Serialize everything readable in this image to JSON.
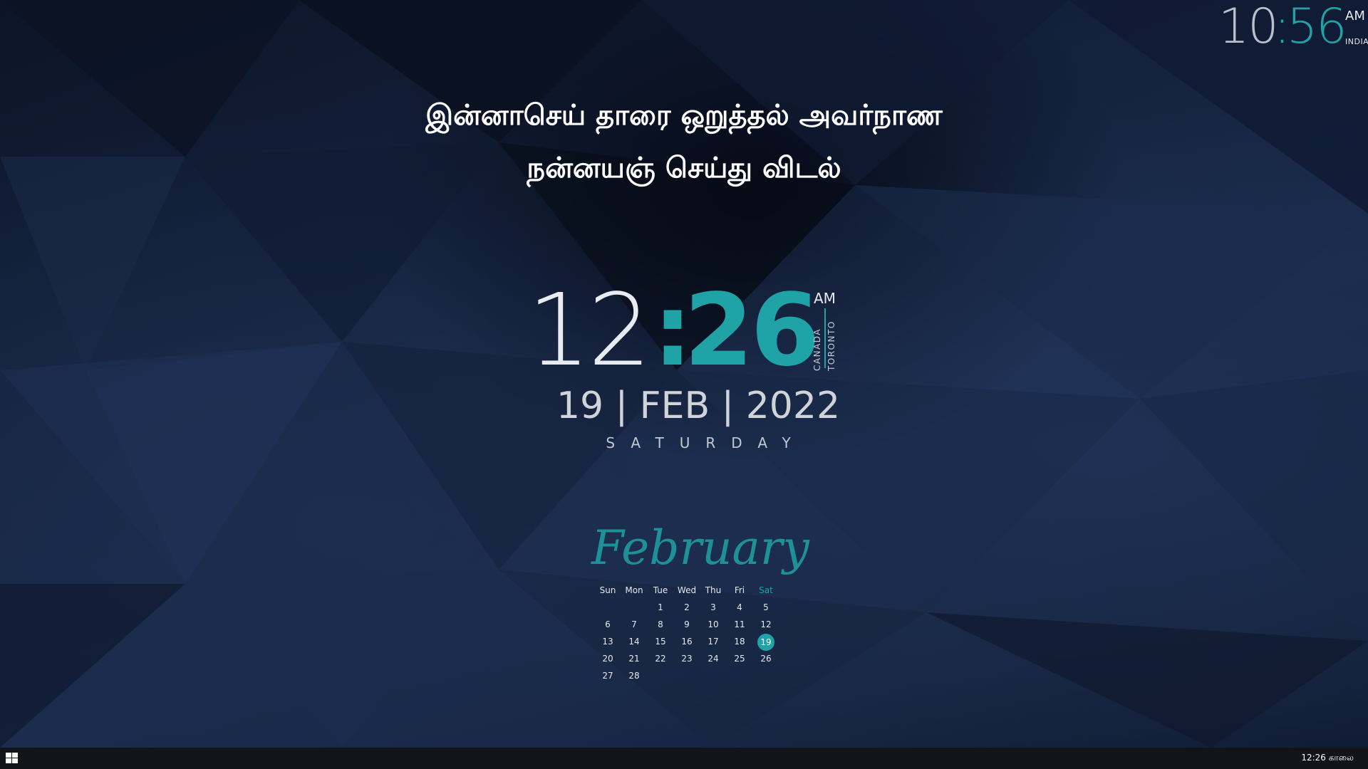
{
  "india_clock": {
    "hour": "10",
    "colon": ":",
    "minute": "56",
    "ampm": "AM",
    "zone": "INDIA"
  },
  "quote": {
    "line1": "இன்னாசெய் தாரை ஒறுத்தல் அவர்நாண",
    "line2": "நன்னயஞ் செய்து விடல்"
  },
  "main_clock": {
    "hour": "12",
    "colon": ":",
    "minute": "26",
    "ampm": "AM",
    "country": "CANADA",
    "city": "TORONTO"
  },
  "date": {
    "line": "19 | FEB | 2022",
    "weekday": "SATURDAY"
  },
  "calendar": {
    "month": "February",
    "weekdays": [
      "Sun",
      "Mon",
      "Tue",
      "Wed",
      "Thu",
      "Fri",
      "Sat"
    ],
    "weeks": [
      [
        "",
        "",
        "1",
        "2",
        "3",
        "4",
        "5"
      ],
      [
        "6",
        "7",
        "8",
        "9",
        "10",
        "11",
        "12"
      ],
      [
        "13",
        "14",
        "15",
        "16",
        "17",
        "18",
        "19"
      ],
      [
        "20",
        "21",
        "22",
        "23",
        "24",
        "25",
        "26"
      ],
      [
        "27",
        "28",
        "",
        "",
        "",
        "",
        ""
      ]
    ],
    "today": "19"
  },
  "taskbar": {
    "time": "12:26 காலை",
    "start_icon": "windows-logo-icon"
  },
  "colors": {
    "accent": "#1fa3a6",
    "bg_dark": "#0c1528",
    "taskbar": "#121417"
  }
}
